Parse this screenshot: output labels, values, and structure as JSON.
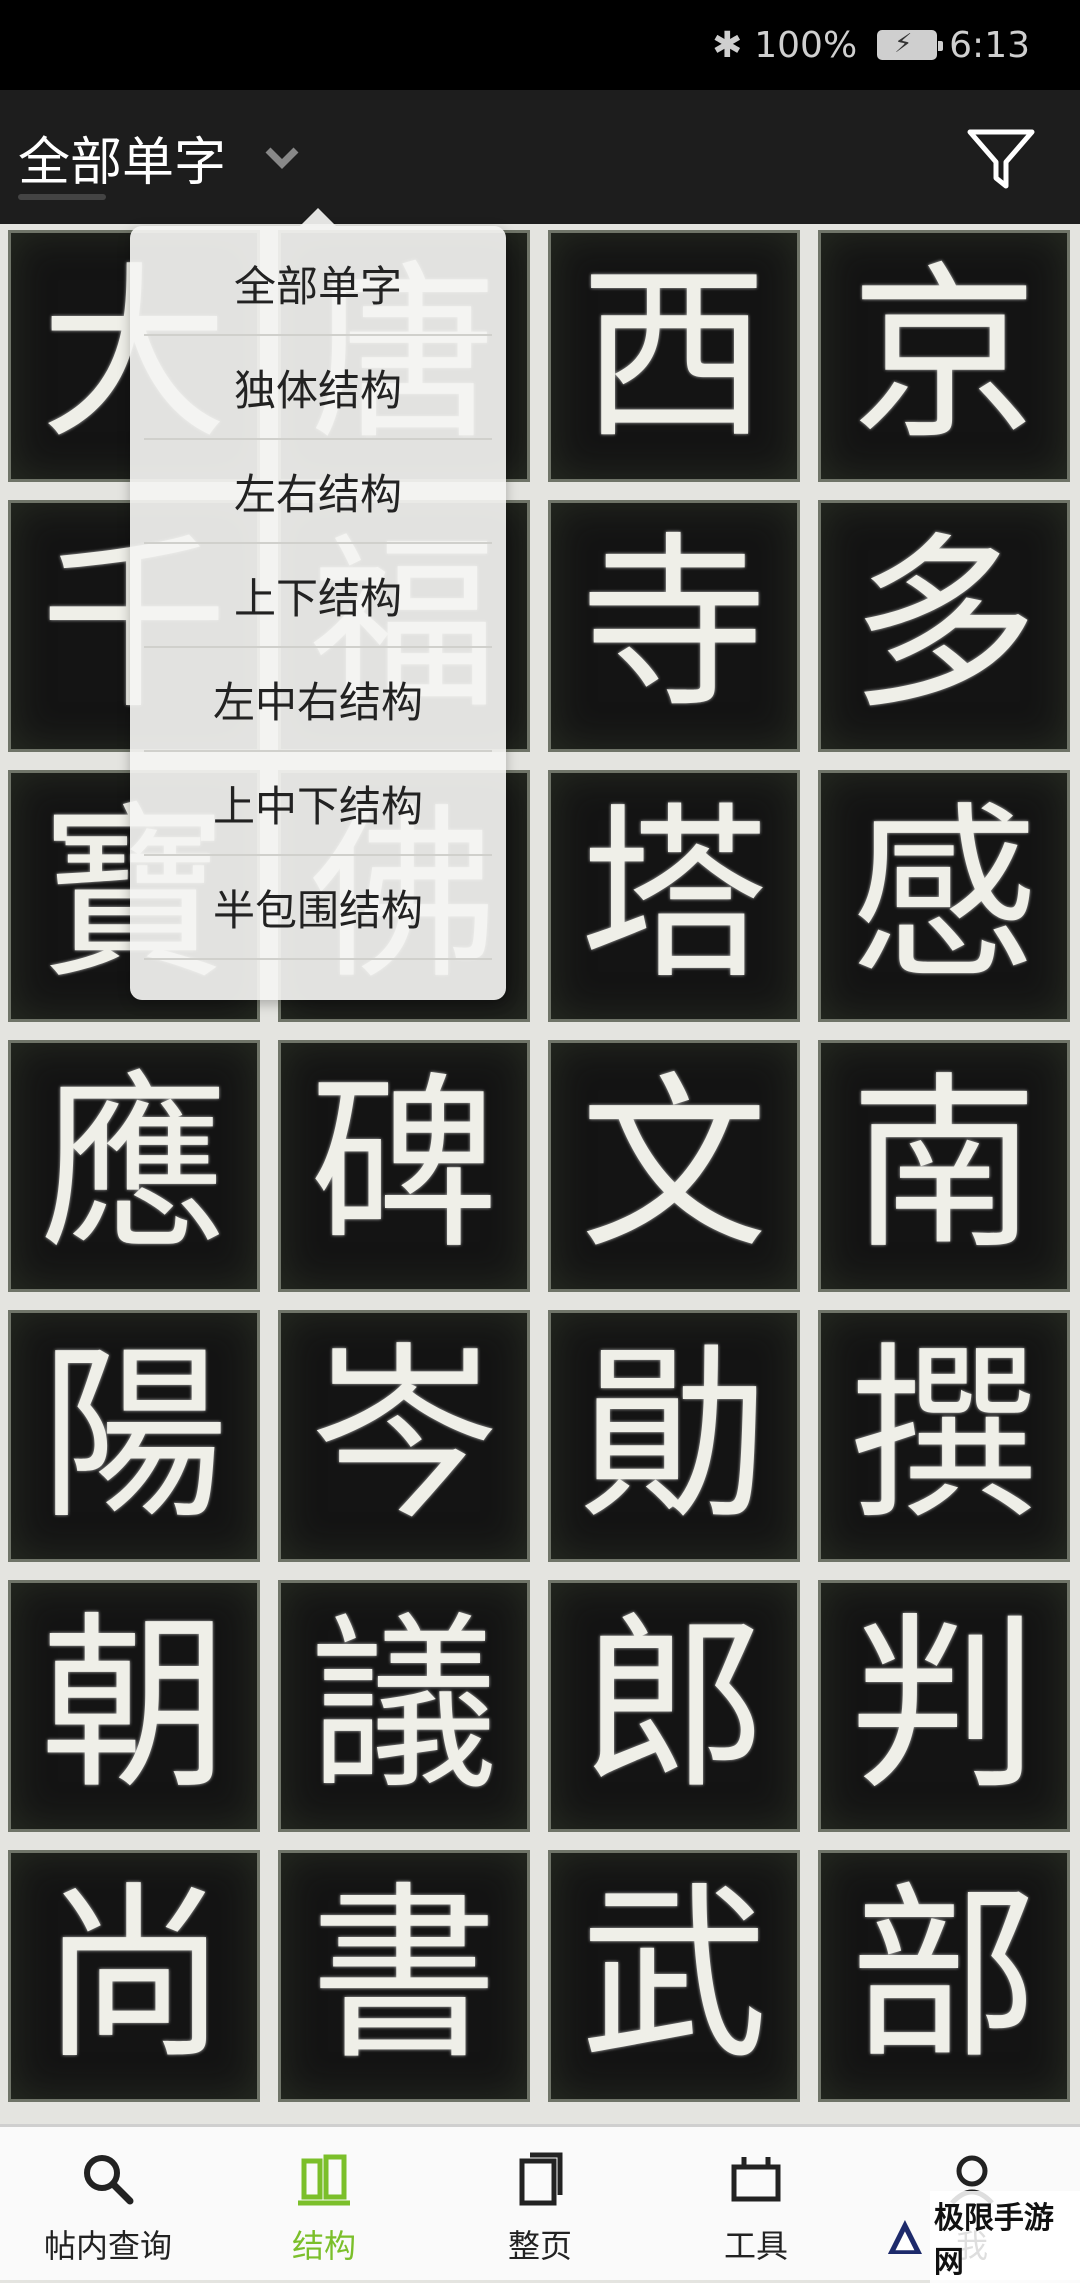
{
  "status_bar": {
    "battery": "100%",
    "time": "6:13"
  },
  "header": {
    "title": "全部单字",
    "icons": [
      "chevron-down-icon",
      "filter-icon"
    ]
  },
  "dropdown": {
    "options": [
      "全部单字",
      "独体结构",
      "左右结构",
      "上下结构",
      "左中右结构",
      "上中下结构",
      "半包围结构"
    ]
  },
  "grid": {
    "characters": [
      "大",
      "唐",
      "西",
      "京",
      "千",
      "福",
      "寺",
      "多",
      "寶",
      "佛",
      "塔",
      "感",
      "應",
      "碑",
      "文",
      "南",
      "陽",
      "岑",
      "勛",
      "撰",
      "朝",
      "議",
      "郎",
      "判",
      "尚",
      "書",
      "武",
      "部"
    ]
  },
  "bottom_nav": {
    "items": [
      {
        "label": "帖内查询",
        "icon": "search-icon"
      },
      {
        "label": "结构",
        "icon": "structure-icon"
      },
      {
        "label": "整页",
        "icon": "page-icon"
      },
      {
        "label": "工具",
        "icon": "toolbox-icon"
      },
      {
        "label": "我",
        "icon": "profile-icon"
      }
    ],
    "active_index": 1,
    "active_color": "#7bbf2a"
  },
  "watermark": {
    "text": "极限手游网"
  }
}
